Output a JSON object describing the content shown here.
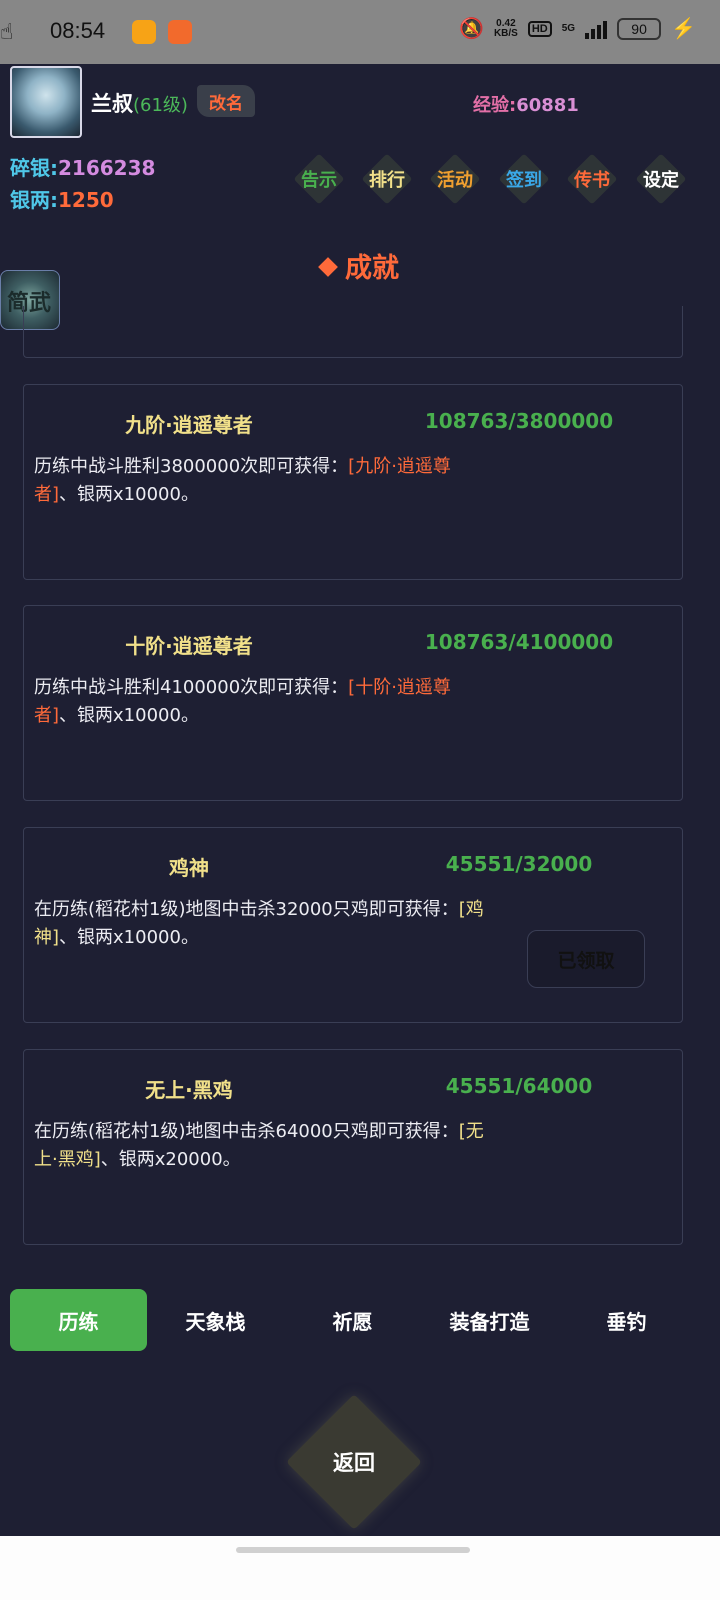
{
  "status_bar": {
    "time": "08:54",
    "speed_value": "0.42",
    "speed_unit": "KB/S",
    "hd_label": "HD",
    "network": "5G",
    "battery": "90",
    "icons": [
      "weibo-icon",
      "book-app-icon",
      "touch-hand-icon",
      "mute-bell-icon",
      "signal-icon",
      "charging-icon"
    ]
  },
  "player": {
    "name": "兰叔",
    "level": "(61级)",
    "rename_label": "改名",
    "exp_label": "经验:",
    "exp_value": "60881",
    "silver1_label": "碎银:",
    "silver1_value": "2166238",
    "silver2_label": "银两:",
    "silver2_value": "1250"
  },
  "top_menu": [
    {
      "label": "告示",
      "color": "#49b04e"
    },
    {
      "label": "排行",
      "color": "#f1e08a"
    },
    {
      "label": "活动",
      "color": "#f0a030"
    },
    {
      "label": "签到",
      "color": "#3aa8e8"
    },
    {
      "label": "传书",
      "color": "#ff6a3a"
    },
    {
      "label": "设定",
      "color": "#ffffff"
    }
  ],
  "side_icon_text": "简武",
  "section_title": "成就",
  "achievements": [
    {
      "title": "九阶·逍遥尊者",
      "progress": "108763/3800000",
      "desc_prefix": "历练中战斗胜利3800000次即可获得：",
      "reward_name": "[九阶·逍遥尊者]",
      "desc_suffix": "、银两x10000。",
      "reward_color": "red",
      "claimed": false
    },
    {
      "title": "十阶·逍遥尊者",
      "progress": "108763/4100000",
      "desc_prefix": "历练中战斗胜利4100000次即可获得：",
      "reward_name": "[十阶·逍遥尊者]",
      "desc_suffix": "、银两x10000。",
      "reward_color": "red",
      "claimed": false
    },
    {
      "title": "鸡神",
      "progress": "45551/32000",
      "desc_prefix": "在历练(稻花村1级)地图中击杀32000只鸡即可获得：",
      "reward_name": "[鸡神]",
      "desc_suffix": "、银两x10000。",
      "reward_color": "yellow",
      "claimed": true,
      "claimed_label": "已领取"
    },
    {
      "title": "无上·黑鸡",
      "progress": "45551/64000",
      "desc_prefix": "在历练(稻花村1级)地图中击杀64000只鸡即可获得：",
      "reward_name": "[无上·黑鸡]",
      "desc_suffix": "、银两x20000。",
      "reward_color": "yellow",
      "claimed": false
    }
  ],
  "tabs": [
    {
      "label": "历练",
      "active": true
    },
    {
      "label": "天象栈",
      "active": false
    },
    {
      "label": "祈愿",
      "active": false
    },
    {
      "label": "装备打造",
      "active": false
    },
    {
      "label": "垂钓",
      "active": false
    }
  ],
  "back_label": "返回"
}
